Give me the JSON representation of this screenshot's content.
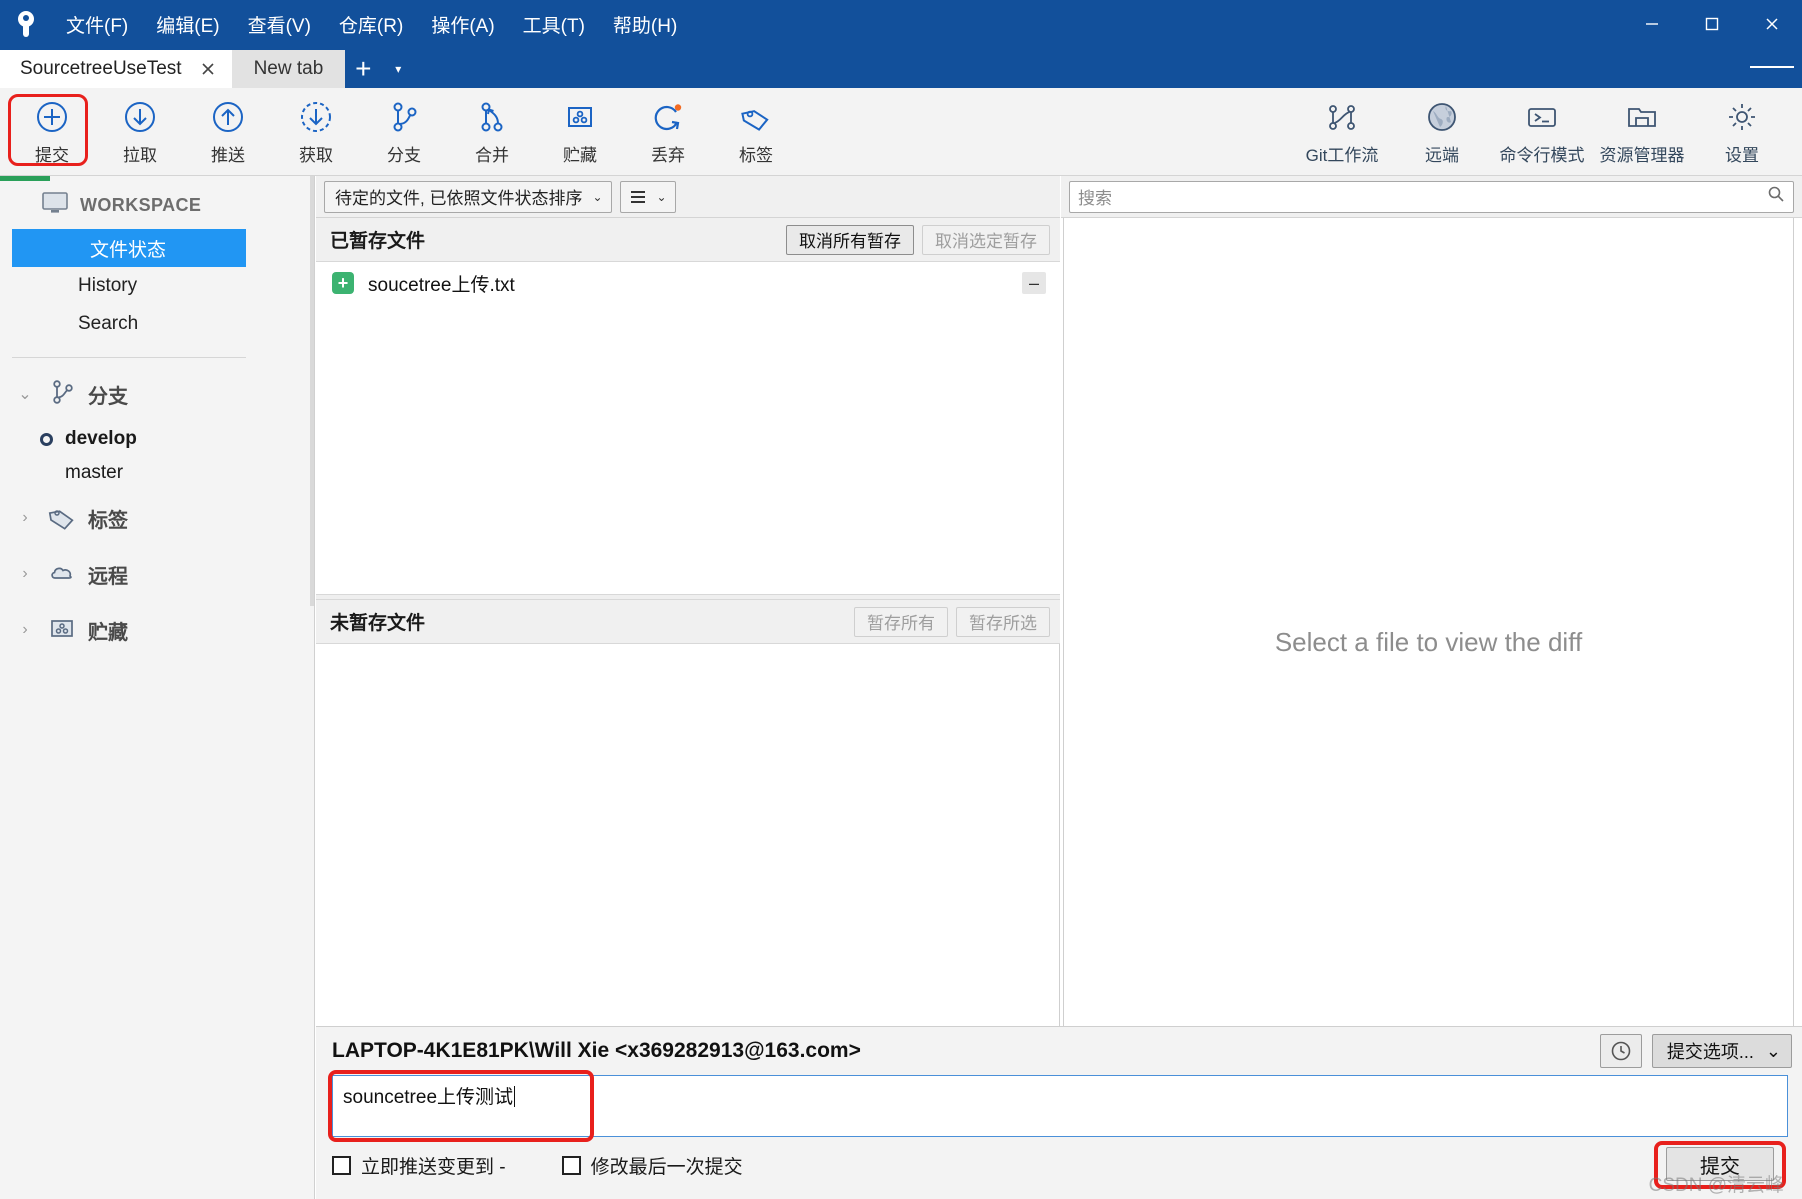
{
  "titlebar": {
    "menus": [
      "文件(F)",
      "编辑(E)",
      "查看(V)",
      "仓库(R)",
      "操作(A)",
      "工具(T)",
      "帮助(H)"
    ],
    "window_controls": [
      "minimize",
      "maximize",
      "close"
    ]
  },
  "tabs": {
    "items": [
      {
        "label": "SourcetreeUseTest",
        "active": true,
        "closable": true
      },
      {
        "label": "New tab",
        "active": false,
        "closable": false
      }
    ],
    "add_label": "+",
    "caret_label": "▾"
  },
  "toolbar": {
    "left": [
      {
        "label": "提交",
        "icon": "commit-plus-icon",
        "highlighted": true
      },
      {
        "label": "拉取",
        "icon": "pull-down-arrow-icon"
      },
      {
        "label": "推送",
        "icon": "push-up-arrow-icon"
      },
      {
        "label": "获取",
        "icon": "fetch-dashed-arrow-icon"
      },
      {
        "label": "分支",
        "icon": "branch-icon"
      },
      {
        "label": "合并",
        "icon": "merge-icon"
      },
      {
        "label": "贮藏",
        "icon": "stash-icon"
      },
      {
        "label": "丢弃",
        "icon": "discard-refresh-icon"
      },
      {
        "label": "标签",
        "icon": "tag-icon"
      }
    ],
    "right": [
      {
        "label": "Git工作流",
        "icon": "gitflow-icon"
      },
      {
        "label": "远端",
        "icon": "globe-remote-icon"
      },
      {
        "label": "命令行模式",
        "icon": "terminal-icon"
      },
      {
        "label": "资源管理器",
        "icon": "folder-explorer-icon"
      },
      {
        "label": "设置",
        "icon": "gear-icon"
      }
    ]
  },
  "sidebar": {
    "workspace_label": "WORKSPACE",
    "workspace_icon": "monitor-icon",
    "items": [
      {
        "label": "文件状态",
        "selected": true
      },
      {
        "label": "History",
        "selected": false
      },
      {
        "label": "Search",
        "selected": false
      }
    ],
    "groups": [
      {
        "label": "分支",
        "icon": "branch-icon",
        "expanded": true,
        "chevron": "⌄",
        "branches": [
          {
            "name": "develop",
            "current": true
          },
          {
            "name": "master",
            "current": false
          }
        ]
      },
      {
        "label": "标签",
        "icon": "tag-icon",
        "expanded": false,
        "chevron": "›",
        "branches": []
      },
      {
        "label": "远程",
        "icon": "cloud-icon",
        "expanded": false,
        "chevron": "›",
        "branches": []
      },
      {
        "label": "贮藏",
        "icon": "stash-icon",
        "expanded": false,
        "chevron": "›",
        "branches": []
      }
    ]
  },
  "center": {
    "filter": {
      "sort_value": "待定的文件, 已依照文件状态排序",
      "caret": "⌄",
      "view_icon": "list-view-icon"
    },
    "staged": {
      "title": "已暂存文件",
      "buttons": [
        {
          "label": "取消所有暂存",
          "disabled": false
        },
        {
          "label": "取消选定暂存",
          "disabled": true
        }
      ],
      "files": [
        {
          "name": "soucetree上传.txt",
          "status": "added",
          "status_glyph": "+",
          "action_glyph": "–"
        }
      ]
    },
    "unstaged": {
      "title": "未暂存文件",
      "buttons": [
        {
          "label": "暂存所有",
          "disabled": true
        },
        {
          "label": "暂存所选",
          "disabled": true
        }
      ],
      "files": []
    }
  },
  "diff": {
    "search_placeholder": "搜索",
    "search_icon": "search-icon",
    "empty_message": "Select a file to view the diff"
  },
  "commit": {
    "author": "LAPTOP-4K1E81PK\\Will Xie <x369282913@163.com>",
    "history_icon": "clock-history-icon",
    "options_label": "提交选项...",
    "options_caret": "⌄",
    "message_value": "souncetree上传测试",
    "checkboxes": [
      {
        "label": "立即推送变更到 -",
        "checked": false
      },
      {
        "label": "修改最后一次提交",
        "checked": false
      }
    ],
    "commit_button_label": "提交",
    "watermark": "CSDN @清云峰"
  },
  "colors": {
    "titlebar_blue": "#12509b",
    "selection_blue": "#2196f3",
    "icon_blue": "#1b64c4",
    "highlight_red": "#e8201c",
    "added_green": "#3cb371",
    "toolbar_bg": "#f3f3f3"
  }
}
